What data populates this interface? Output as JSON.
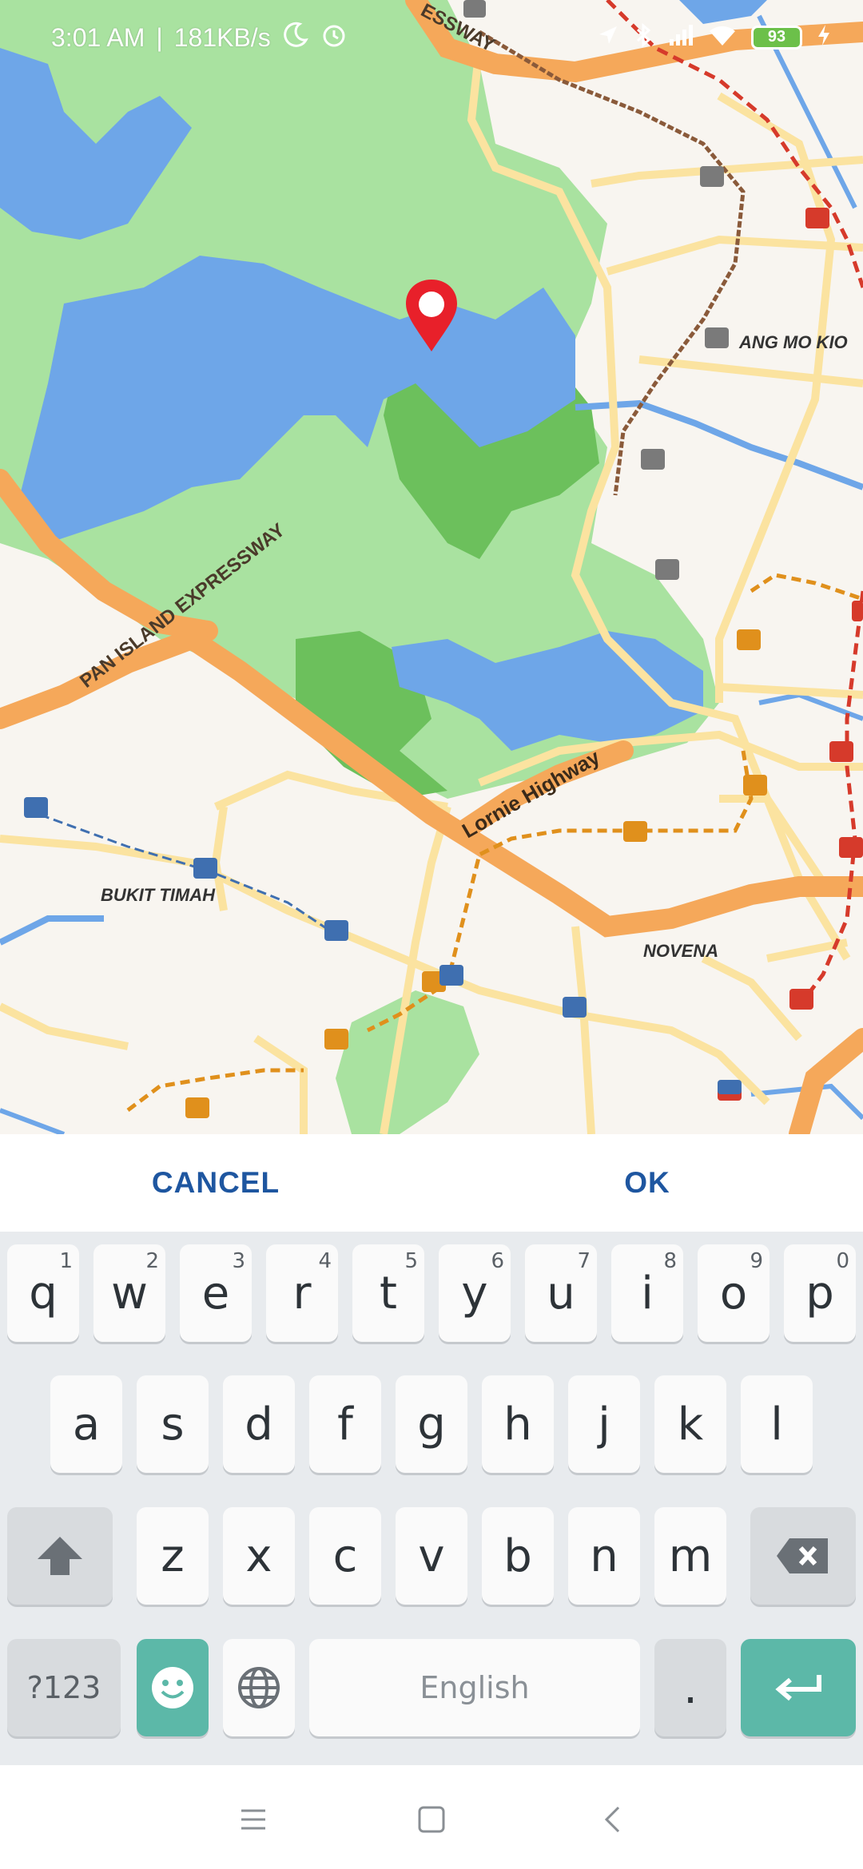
{
  "status_bar": {
    "time": "3:01 AM",
    "speed": "181KB/s",
    "battery": "93"
  },
  "map": {
    "labels": {
      "pie_expressway": "PAN ISLAND EXPRESSWAY",
      "expressway_top": "ESSWAY",
      "ang_mo_kio": "ANG MO KIO",
      "lornie_highway": "Lornie Highway",
      "bukit_timah": "BUKIT TIMAH",
      "novena": "NOVENA"
    },
    "colors": {
      "land": "#f8f5f0",
      "park_light": "#a9e2a0",
      "park_dark": "#6cc05c",
      "water": "#6ea6e8",
      "expressway": "#f5a85a",
      "road": "#fbe3a0",
      "mrt_red": "#d63a2b",
      "mrt_brown": "#8a5a3a",
      "mrt_orange": "#e0901c",
      "pin": "#e8202a"
    }
  },
  "dialog": {
    "cancel_label": "CANCEL",
    "ok_label": "OK"
  },
  "keyboard": {
    "row1": [
      {
        "key": "q",
        "hint": "1"
      },
      {
        "key": "w",
        "hint": "2"
      },
      {
        "key": "e",
        "hint": "3"
      },
      {
        "key": "r",
        "hint": "4"
      },
      {
        "key": "t",
        "hint": "5"
      },
      {
        "key": "y",
        "hint": "6"
      },
      {
        "key": "u",
        "hint": "7"
      },
      {
        "key": "i",
        "hint": "8"
      },
      {
        "key": "o",
        "hint": "9"
      },
      {
        "key": "p",
        "hint": "0"
      }
    ],
    "row2": [
      "a",
      "s",
      "d",
      "f",
      "g",
      "h",
      "j",
      "k",
      "l"
    ],
    "row3": [
      "z",
      "x",
      "c",
      "v",
      "b",
      "n",
      "m"
    ],
    "symbols_label": "?123",
    "space_label": "English",
    "period_label": "."
  }
}
